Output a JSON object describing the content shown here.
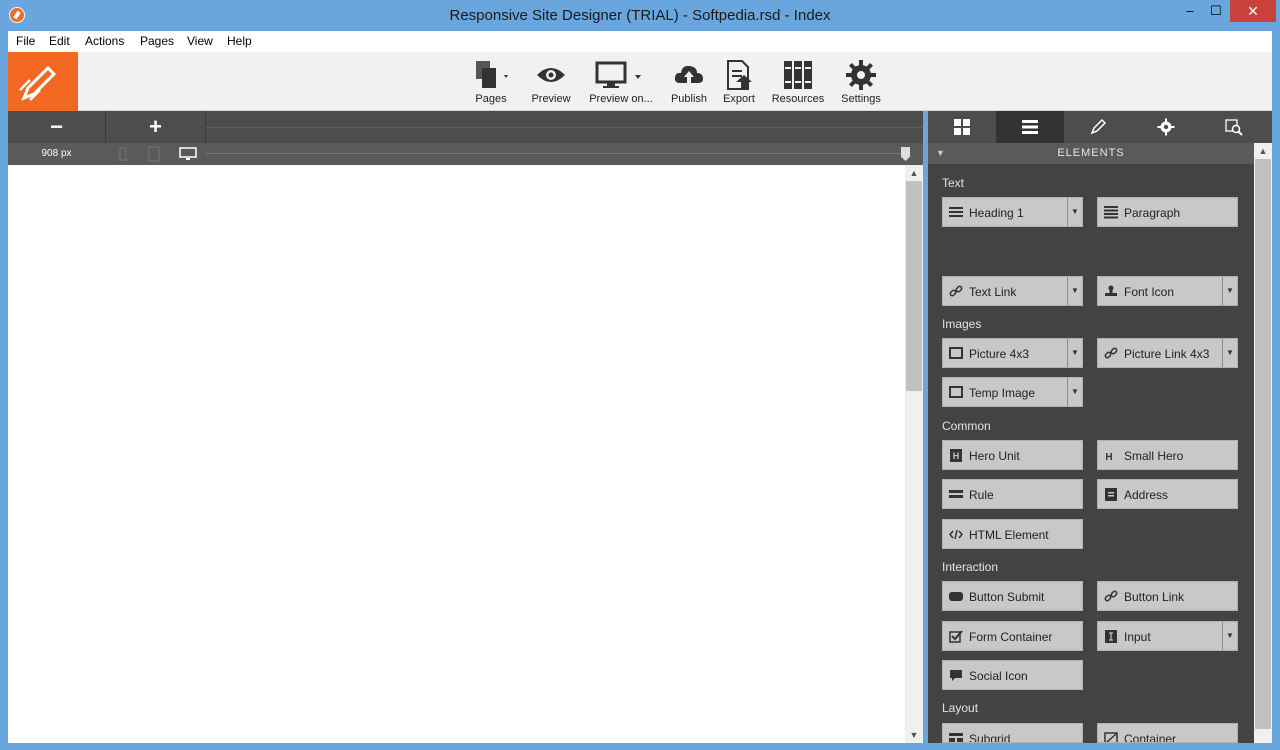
{
  "window": {
    "title": "Responsive Site Designer (TRIAL) - Softpedia.rsd - Index",
    "controls": {
      "minimize": "–",
      "maximize": "☐",
      "close": "✕"
    }
  },
  "menu": [
    "File",
    "Edit",
    "Actions",
    "Pages",
    "View",
    "Help"
  ],
  "toolbar": {
    "logo": "pencil-rocket-logo",
    "tools": [
      {
        "label": "Pages",
        "icon": "pages-icon"
      },
      {
        "label": "Preview",
        "icon": "eye-icon"
      },
      {
        "label": "Preview on...",
        "icon": "monitor-icon"
      },
      {
        "label": "Publish",
        "icon": "cloud-upload-icon"
      },
      {
        "label": "Export",
        "icon": "export-icon"
      },
      {
        "label": "Resources",
        "icon": "books-icon"
      },
      {
        "label": "Settings",
        "icon": "gear-icon"
      }
    ]
  },
  "canvas": {
    "zoom_out": "−",
    "zoom_in": "+",
    "width_label": "908 px",
    "devices": [
      "phone-icon",
      "tablet-icon",
      "desktop-icon"
    ]
  },
  "panel": {
    "tabs": [
      "grid-icon",
      "list-icon",
      "brush-icon",
      "gear-icon",
      "inspect-icon"
    ],
    "active_tab": 1,
    "header": "ELEMENTS",
    "sections": [
      {
        "title": "Text"
      },
      {
        "title": "Images"
      },
      {
        "title": "Common"
      },
      {
        "title": "Interaction"
      },
      {
        "title": "Layout"
      }
    ],
    "elements": {
      "heading1": "Heading 1",
      "paragraph": "Paragraph",
      "text_link": "Text Link",
      "font_icon": "Font Icon",
      "picture": "Picture 4x3",
      "picture_link": "Picture Link 4x3",
      "temp_image": "Temp Image",
      "hero_unit": "Hero Unit",
      "small_hero": "Small Hero",
      "rule": "Rule",
      "address": "Address",
      "html_element": "HTML Element",
      "button_submit": "Button Submit",
      "button_link": "Button Link",
      "form_container": "Form Container",
      "input": "Input",
      "social_icon": "Social Icon",
      "subgrid": "Subgrid",
      "container": "Container"
    }
  },
  "colors": {
    "title_bar": "#6aa6de",
    "logo": "#f26722",
    "panel_bg": "#434343",
    "button_bg": "#c8c8c8",
    "close_button": "#c8423b"
  }
}
